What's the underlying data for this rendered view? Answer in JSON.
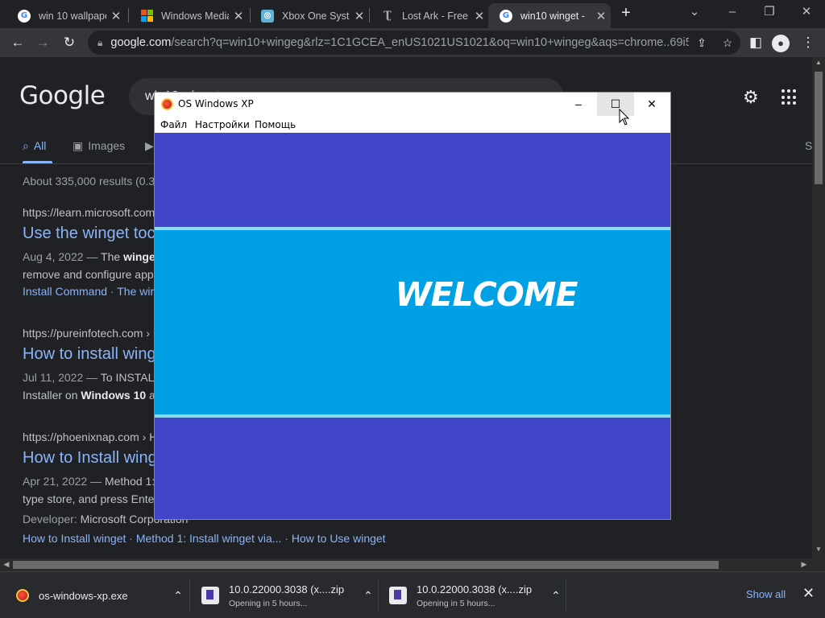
{
  "browser": {
    "tabs": [
      {
        "title": "win 10 wallpape",
        "favicon": "google-icon"
      },
      {
        "title": "Windows Media",
        "favicon": "microsoft-icon"
      },
      {
        "title": "Xbox One Syste",
        "favicon": "xbox-icon"
      },
      {
        "title": "Lost Ark - Free t",
        "favicon": "lost-ark-icon"
      },
      {
        "title": "win10 winget - ",
        "favicon": "google-icon",
        "active": true
      }
    ],
    "new_tab_label": "+",
    "address": {
      "host": "google.com",
      "path": "/search?q=win10+wingeg&rlz=1C1GCEA_enUS1021US1021&oq=win10+wingeg&aqs=chrome..69i5..."
    }
  },
  "google": {
    "logo": "Google",
    "query": "win10 winget",
    "tabs": [
      "All",
      "Images"
    ],
    "tab_more": "S",
    "stats": "About 335,000 results (0.3",
    "results": [
      {
        "cite": "https://learn.microsoft.com",
        "title": "Use the winget toc",
        "date": "Aug 4, 2022 —",
        "snippet_pre": "The ",
        "snippet_bold": "winge",
        "snippet_line2": "remove and configure app",
        "sitelinks": [
          "Install Command",
          "The wir"
        ]
      },
      {
        "cite": "https://pureinfotech.com ›",
        "title": "How to install wing",
        "date": "Jul 11, 2022 —",
        "snippet_pre": "To INSTAL",
        "snippet_line2_pre": "Installer on ",
        "snippet_line2_bold": "Windows 10",
        "snippet_line2_post": " a"
      },
      {
        "cite": "https://phoenixnap.com › H",
        "title": "How to Install wing",
        "date": "Apr 21, 2022 —",
        "snippet_pre": "Method 1:",
        "snippet_line2": "type store, and press Ente",
        "developer_label": "Developer:",
        "developer": "Microsoft Corporation",
        "sitelinks": [
          "How to Install winget",
          "Method 1: Install winget via...",
          "How to Use winget"
        ]
      }
    ]
  },
  "downloads": [
    {
      "name": "os-windows-xp.exe",
      "status": "",
      "icon": "os-windows-xp-icon"
    },
    {
      "name": "10.0.22000.3038 (x....zip",
      "status": "Opening in 5 hours...",
      "icon": "zip-archive-icon"
    },
    {
      "name": "10.0.22000.3038 (x....zip",
      "status": "Opening in 5 hours...",
      "icon": "zip-archive-icon"
    }
  ],
  "show_all": "Show all",
  "app_window": {
    "title": "OS Windows XP",
    "menu": [
      "Файл",
      "Настройки",
      "Помощь"
    ],
    "welcome": "WELCOME",
    "colors": {
      "background": "#4146c9",
      "band": "#00a1e4",
      "band_border": "#8fd7f3"
    }
  }
}
